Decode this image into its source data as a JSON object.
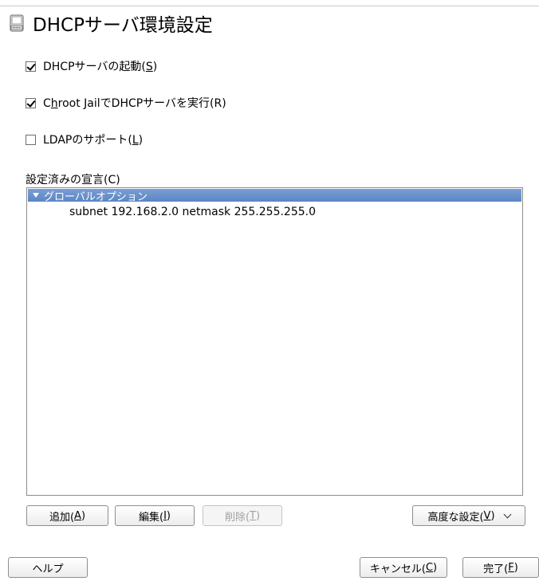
{
  "window": {
    "title": "DHCPサーバ環境設定"
  },
  "options": {
    "start_dhcp": {
      "label_pre": "DHCPサーバの起動(",
      "mnemonic": "S",
      "label_post": ")",
      "checked": true
    },
    "chroot": {
      "label_pre": "C",
      "mnemonic": "h",
      "label_post": "root JailでDHCPサーバを実行(R)",
      "checked": true
    },
    "ldap": {
      "label_pre": "LDAPのサポート(",
      "mnemonic": "L",
      "label_post": ")",
      "checked": false
    }
  },
  "declarations": {
    "label": "設定済みの宣言(C)",
    "items": [
      {
        "label": "グローバルオプション",
        "expanded": true,
        "selected": true
      },
      {
        "label": "subnet 192.168.2.0 netmask 255.255.255.0"
      }
    ]
  },
  "buttons": {
    "add": {
      "pre": "追加(",
      "m": "A",
      "post": ")"
    },
    "edit": {
      "pre": "編集(",
      "m": "I",
      "post": ")"
    },
    "delete": {
      "pre": "削除(",
      "m": "T",
      "post": ")"
    },
    "advanced": {
      "pre": "高度な設定(",
      "m": "V",
      "post": ")"
    },
    "help": {
      "label": "ヘルプ"
    },
    "cancel": {
      "pre": "キャンセル(",
      "m": "C",
      "post": ")"
    },
    "finish": {
      "pre": "完了(",
      "m": "F",
      "post": ")"
    }
  }
}
